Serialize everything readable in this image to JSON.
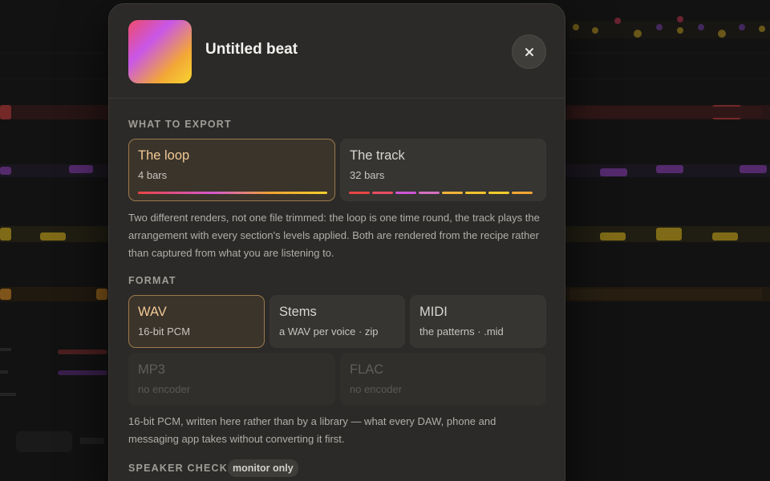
{
  "dialog": {
    "title": "Untitled beat",
    "close_icon": "close-icon"
  },
  "export_section": {
    "label": "WHAT TO EXPORT",
    "options": [
      {
        "name": "The loop",
        "detail": "4 bars",
        "selected": true
      },
      {
        "name": "The track",
        "detail": "32 bars",
        "selected": false
      }
    ],
    "description": "Two different renders, not one file trimmed: the loop is one time round, the track plays the arrangement with every section's levels applied. Both are rendered from the recipe rather than captured from what you are listening to."
  },
  "format_section": {
    "label": "FORMAT",
    "options": [
      {
        "name": "WAV",
        "detail": "16-bit PCM",
        "selected": true,
        "disabled": false
      },
      {
        "name": "Stems",
        "detail": "a WAV per voice · zip",
        "selected": false,
        "disabled": false
      },
      {
        "name": "MIDI",
        "detail": "the patterns · .mid",
        "selected": false,
        "disabled": false
      },
      {
        "name": "MP3",
        "detail": "no encoder",
        "selected": false,
        "disabled": true
      },
      {
        "name": "FLAC",
        "detail": "no encoder",
        "selected": false,
        "disabled": true
      }
    ],
    "description": "16-bit PCM, written here rather than by a library — what every DAW, phone and messaging app takes without converting it first."
  },
  "speaker_section": {
    "label": "SPEAKER CHECK",
    "badge": "monitor only"
  },
  "colors": {
    "accent": "#f2c995",
    "selected_border": "#9c7a4c",
    "track_segments": [
      "#e84545",
      "#e84e62",
      "#cf55d6",
      "#d570c0",
      "#f0b33a",
      "#f5c32f",
      "#f5cb2c",
      "#f2a534"
    ]
  }
}
